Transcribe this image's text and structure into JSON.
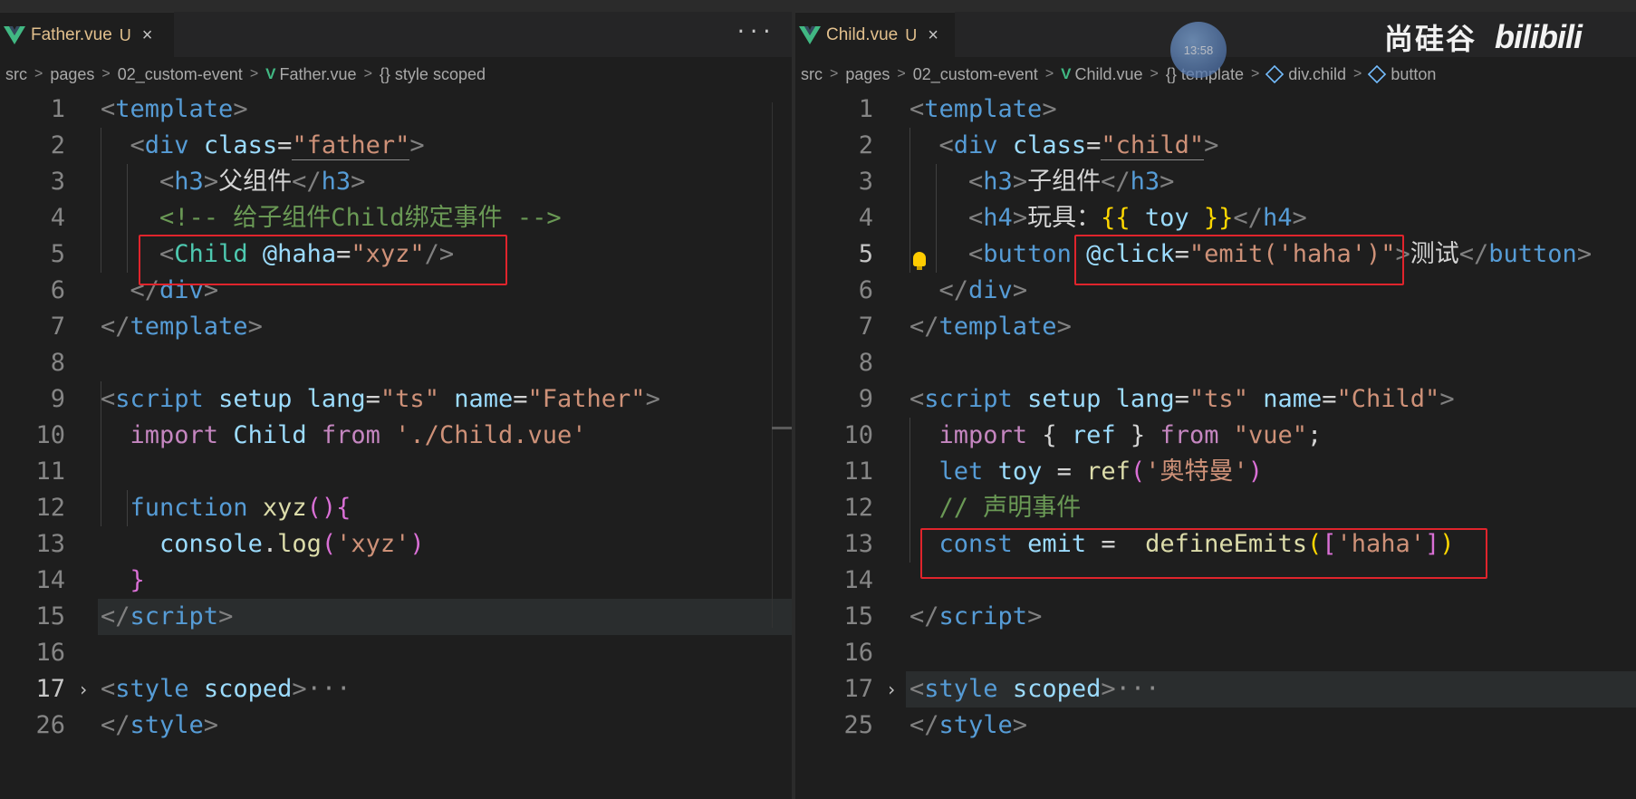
{
  "left": {
    "tab": {
      "name": "Father.vue",
      "badge": "U",
      "close": "×"
    },
    "more": "···",
    "breadcrumb": [
      "src",
      "pages",
      "02_custom-event",
      "Father.vue",
      "{} style scoped"
    ],
    "lines": [
      "1",
      "2",
      "3",
      "4",
      "5",
      "6",
      "7",
      "8",
      "9",
      "10",
      "11",
      "12",
      "13",
      "14",
      "15",
      "16",
      "17",
      "26"
    ],
    "code": {
      "l2_class": "\"father\"",
      "l3_text": "父组件",
      "l4_comment": "<!-- 给子组件Child绑定事件 -->",
      "l5_attr": "@haha",
      "l5_val": "\"xyz\"",
      "l9_lang": "\"ts\"",
      "l9_name": "\"Father\"",
      "l10_path": "'./Child.vue'",
      "l12_fn": "xyz",
      "l13_arg": "'xyz'"
    }
  },
  "right": {
    "tab": {
      "name": "Child.vue",
      "badge": "U",
      "close": "×"
    },
    "breadcrumb": [
      "src",
      "pages",
      "02_custom-event",
      "Child.vue",
      "{} template",
      "div.child",
      "button"
    ],
    "lines": [
      "1",
      "2",
      "3",
      "4",
      "5",
      "6",
      "7",
      "8",
      "9",
      "10",
      "11",
      "12",
      "13",
      "14",
      "15",
      "16",
      "17",
      "25"
    ],
    "code": {
      "l2_class": "\"child\"",
      "l3_text": "子组件",
      "l4_text": "玩具：",
      "l4_expr": "toy",
      "l5_attr": "@click",
      "l5_val": "\"emit('haha')\"",
      "l5_text": "测试",
      "l9_lang": "\"ts\"",
      "l9_name": "\"Child\"",
      "l10_mod": "\"vue\"",
      "l11_val": "'奥特曼'",
      "l12_comment": "// 声明事件",
      "l13_arg": "'haha'"
    }
  },
  "overlay": {
    "clock_time": "13:58",
    "watermark_cn": "尚硅谷",
    "watermark_logo": "bilibili"
  }
}
